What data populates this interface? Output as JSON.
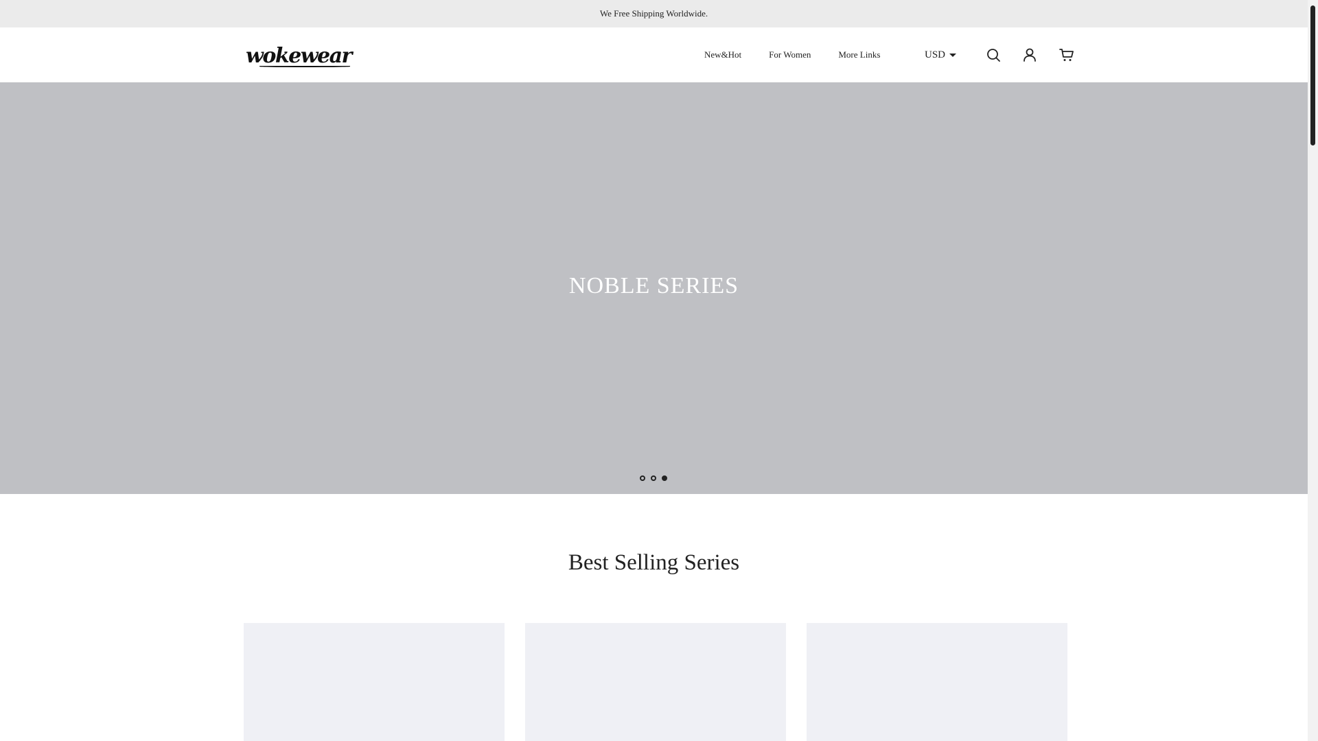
{
  "announcement": {
    "text": "We Free Shipping Worldwide."
  },
  "header": {
    "logo_text": "wokewear",
    "nav": [
      {
        "label": "New&Hot"
      },
      {
        "label": "For Women"
      },
      {
        "label": "More Links"
      }
    ],
    "currency": {
      "selected": "USD"
    },
    "icons": [
      "search-icon",
      "account-icon",
      "cart-icon"
    ]
  },
  "hero": {
    "title": "NOBLE SERIES",
    "slides_count": 3,
    "active_slide": 3
  },
  "best_selling": {
    "title": "Best Selling Series"
  },
  "colors": {
    "announcement_bg": "#ebebeb",
    "hero_bg": "#bfc0c4",
    "card_placeholder": "#eff0f5",
    "text": "#222222"
  }
}
